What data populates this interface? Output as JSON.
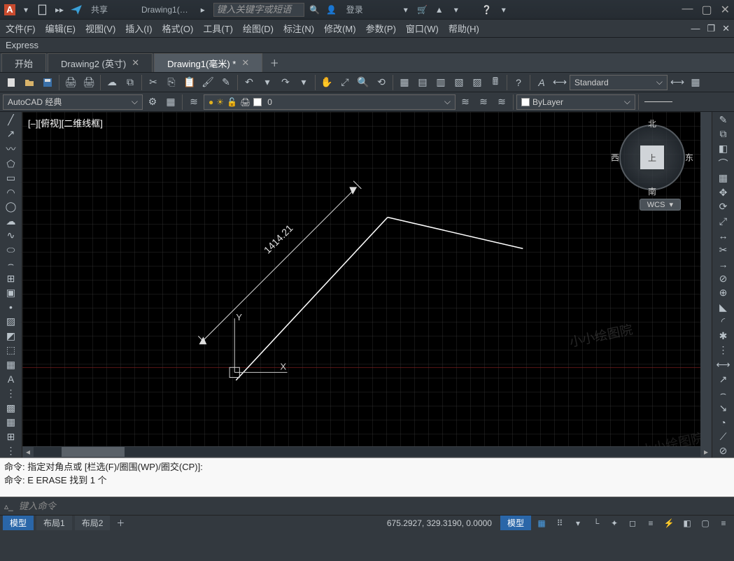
{
  "titlebar": {
    "share": "共享",
    "doc_title": "Drawing1(…",
    "search_placeholder": "键入关键字或短语",
    "login": "登录"
  },
  "menubar": {
    "file": "文件(F)",
    "edit": "编辑(E)",
    "view": "视图(V)",
    "insert": "插入(I)",
    "format": "格式(O)",
    "tools": "工具(T)",
    "draw": "绘图(D)",
    "dim": "标注(N)",
    "modify": "修改(M)",
    "param": "参数(P)",
    "window": "窗口(W)",
    "help": "帮助(H)"
  },
  "express": "Express",
  "tabs": {
    "start": "开始",
    "d2": "Drawing2  (英寸)",
    "d1": "Drawing1(毫米) *"
  },
  "workspace_combo": "AutoCAD 经典",
  "layer_combo": "0",
  "style_combo": "Standard",
  "color_combo": "ByLayer",
  "view_label": "[–][俯视][二维线框]",
  "compass": {
    "n": "北",
    "s": "南",
    "e": "东",
    "w": "西",
    "top": "上"
  },
  "wcs": "WCS",
  "ucs": {
    "x": "X",
    "y": "Y"
  },
  "dimension_value": "1414.21",
  "cmd": {
    "line1": "命令: 指定对角点或 [栏选(F)/圈围(WP)/圈交(CP)]:",
    "line2": "命令: E  ERASE 找到 1 个",
    "placeholder": "键入命令"
  },
  "status": {
    "model": "模型",
    "layout1": "布局1",
    "layout2": "布局2",
    "coords": "675.2927, 329.3190, 0.0000",
    "model_btn": "模型"
  }
}
